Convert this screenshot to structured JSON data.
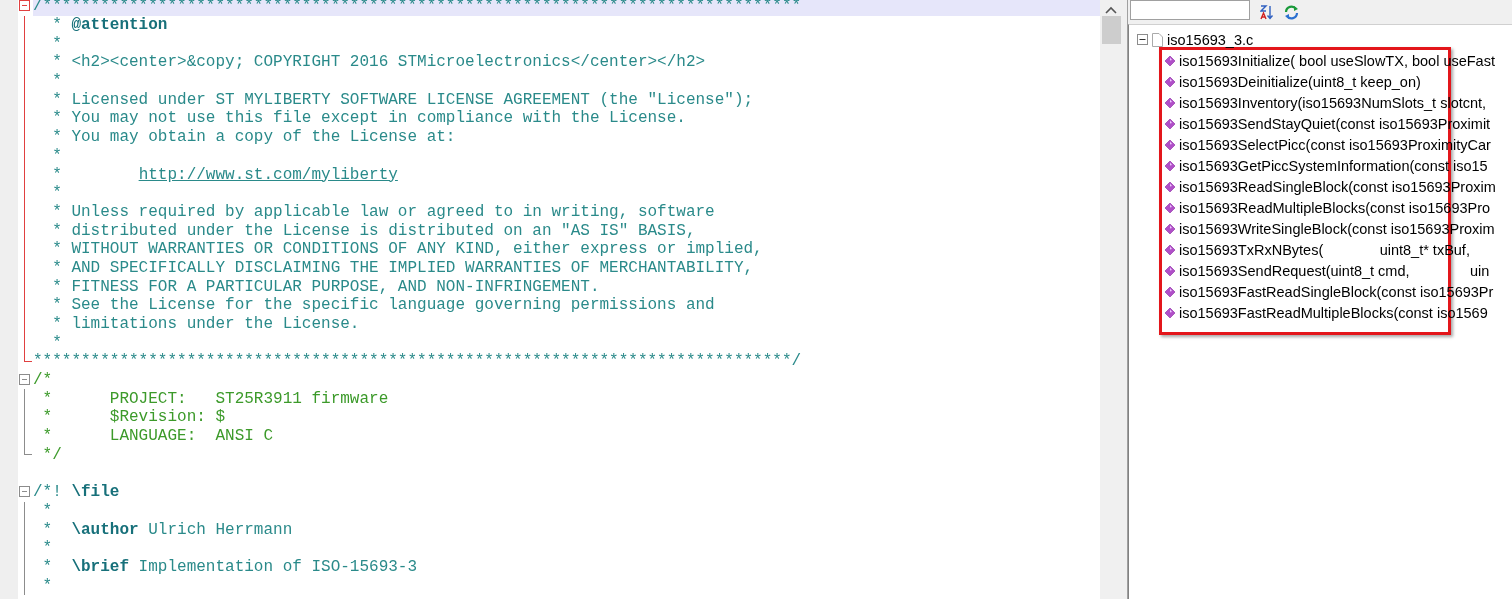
{
  "editor": {
    "blocks": [
      {
        "kind": "doc",
        "expanded": true,
        "closed": true,
        "spaced": false,
        "lines": [
          {
            "text": "/*******************************************************************************",
            "current": true
          },
          {
            "text": "  * ",
            "tag": "@attention",
            "current": false
          },
          {
            "text": "  *",
            "current": false
          },
          {
            "text": "  * <h2><center>&copy; COPYRIGHT 2016 STMicroelectronics</center></h2>",
            "current": false
          },
          {
            "text": "  *",
            "current": false
          },
          {
            "text": "  * Licensed under ST MYLIBERTY SOFTWARE LICENSE AGREEMENT (the \"License\");",
            "current": false
          },
          {
            "text": "  * You may not use this file except in compliance with the License.",
            "current": false
          },
          {
            "text": "  * You may obtain a copy of the License at:",
            "current": false
          },
          {
            "text": "  *",
            "current": false
          },
          {
            "text": "  *        ",
            "link": "http://www.st.com/myliberty",
            "current": false
          },
          {
            "text": "  *",
            "current": false
          },
          {
            "text": "  * Unless required by applicable law or agreed to in writing, software",
            "current": false
          },
          {
            "text": "  * distributed under the License is distributed on an \"AS IS\" BASIS,",
            "current": false
          },
          {
            "text": "  * WITHOUT WARRANTIES OR CONDITIONS OF ANY KIND, either express or implied,",
            "current": false
          },
          {
            "text": "  * AND SPECIFICALLY DISCLAIMING THE IMPLIED WARRANTIES OF MERCHANTABILITY,",
            "current": false
          },
          {
            "text": "  * FITNESS FOR A PARTICULAR PURPOSE, AND NON-INFRINGEMENT.",
            "current": false
          },
          {
            "text": "  * See the License for the specific language governing permissions and",
            "current": false
          },
          {
            "text": "  * limitations under the License.",
            "current": false
          },
          {
            "text": "  *",
            "current": false
          },
          {
            "text": "*******************************************************************************/",
            "current": false
          }
        ]
      },
      {
        "kind": "block",
        "expanded": true,
        "closed": true,
        "spaced": false,
        "lines": [
          {
            "text": "/*",
            "current": false
          },
          {
            "text": " *      PROJECT:   ST25R3911 firmware",
            "current": false
          },
          {
            "text": " *      $Revision: $",
            "current": false
          },
          {
            "text": " *      LANGUAGE:  ANSI C",
            "current": false
          },
          {
            "text": " */",
            "current": false
          }
        ]
      },
      {
        "kind": "doc",
        "expanded": true,
        "closed": false,
        "spaced": true,
        "lines": [
          {
            "text": "/*! ",
            "tag": "\\file",
            "current": false
          },
          {
            "text": " *",
            "current": false
          },
          {
            "text": " *  ",
            "tag": "\\author",
            "rest": " Ulrich Herrmann",
            "current": false
          },
          {
            "text": " *",
            "current": false
          },
          {
            "text": " *  ",
            "tag": "\\brief",
            "rest": " Implementation of ISO-15693-3",
            "current": false
          },
          {
            "text": " *",
            "current": false
          }
        ]
      }
    ]
  },
  "outline": {
    "tree": [
      {
        "label": "iso15693_3.c",
        "expanded": true,
        "children": [
          {
            "label": "iso15693Initialize( bool useSlowTX, bool useFast"
          },
          {
            "label": "iso15693Deinitialize(uint8_t keep_on)"
          },
          {
            "label": "iso15693Inventory(iso15693NumSlots_t slotcnt,"
          },
          {
            "label": "iso15693SendStayQuiet(const iso15693Proximit"
          },
          {
            "label": "iso15693SelectPicc(const iso15693ProximityCar"
          },
          {
            "label": "iso15693GetPiccSystemInformation(const iso15"
          },
          {
            "label": "iso15693ReadSingleBlock(const iso15693Proxim"
          },
          {
            "label": "iso15693ReadMultipleBlocks(const iso15693Pro"
          },
          {
            "label": "iso15693WriteSingleBlock(const iso15693Proxim"
          },
          {
            "label": "iso15693TxRxNBytes(              uint8_t* txBuf,"
          },
          {
            "label": "iso15693SendRequest(uint8_t cmd,               uin"
          },
          {
            "label": "iso15693FastReadSingleBlock(const iso15693Pr"
          },
          {
            "label": "iso15693FastReadMultipleBlocks(const iso1569"
          }
        ]
      }
    ]
  }
}
